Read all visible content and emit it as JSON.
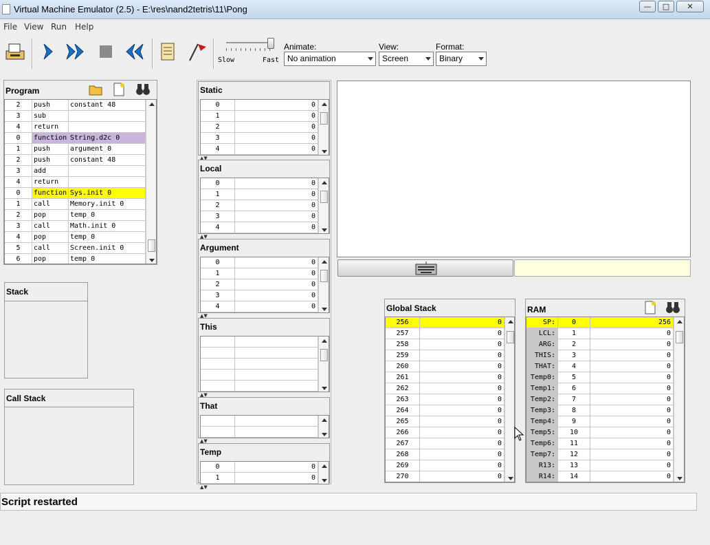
{
  "window": {
    "title": "Virtual Machine Emulator (2.5) - E:\\res\\nand2tetris\\11\\Pong"
  },
  "menu": [
    "File",
    "View",
    "Run",
    "Help"
  ],
  "toolbar": {
    "speed_slow": "Slow",
    "speed_fast": "Fast",
    "animate_label": "Animate:",
    "animate_value": "No animation",
    "view_label": "View:",
    "view_value": "Screen",
    "format_label": "Format:",
    "format_value": "Binary"
  },
  "program": {
    "title": "Program",
    "rows": [
      {
        "n": "2",
        "cmd": "push",
        "arg": "constant 48",
        "hl": ""
      },
      {
        "n": "3",
        "cmd": "sub",
        "arg": "",
        "hl": ""
      },
      {
        "n": "4",
        "cmd": "return",
        "arg": "",
        "hl": ""
      },
      {
        "n": "0",
        "cmd": "function",
        "arg": "String.d2c 0",
        "hl": "purple"
      },
      {
        "n": "1",
        "cmd": "push",
        "arg": "argument 0",
        "hl": ""
      },
      {
        "n": "2",
        "cmd": "push",
        "arg": "constant 48",
        "hl": ""
      },
      {
        "n": "3",
        "cmd": "add",
        "arg": "",
        "hl": ""
      },
      {
        "n": "4",
        "cmd": "return",
        "arg": "",
        "hl": ""
      },
      {
        "n": "0",
        "cmd": "function",
        "arg": "Sys.init 0",
        "hl": "yellow"
      },
      {
        "n": "1",
        "cmd": "call",
        "arg": "Memory.init 0",
        "hl": ""
      },
      {
        "n": "2",
        "cmd": "pop",
        "arg": "temp 0",
        "hl": ""
      },
      {
        "n": "3",
        "cmd": "call",
        "arg": "Math.init 0",
        "hl": ""
      },
      {
        "n": "4",
        "cmd": "pop",
        "arg": "temp 0",
        "hl": ""
      },
      {
        "n": "5",
        "cmd": "call",
        "arg": "Screen.init 0",
        "hl": ""
      },
      {
        "n": "6",
        "cmd": "pop",
        "arg": "temp 0",
        "hl": ""
      }
    ]
  },
  "stack": {
    "title": "Stack"
  },
  "call_stack": {
    "title": "Call Stack"
  },
  "segments": {
    "static": {
      "title": "Static",
      "rows": [
        [
          "0",
          "0"
        ],
        [
          "1",
          "0"
        ],
        [
          "2",
          "0"
        ],
        [
          "3",
          "0"
        ],
        [
          "4",
          "0"
        ]
      ]
    },
    "local": {
      "title": "Local",
      "rows": [
        [
          "0",
          "0"
        ],
        [
          "1",
          "0"
        ],
        [
          "2",
          "0"
        ],
        [
          "3",
          "0"
        ],
        [
          "4",
          "0"
        ]
      ]
    },
    "argument": {
      "title": "Argument",
      "rows": [
        [
          "0",
          "0"
        ],
        [
          "1",
          "0"
        ],
        [
          "2",
          "0"
        ],
        [
          "3",
          "0"
        ],
        [
          "4",
          "0"
        ]
      ]
    },
    "this": {
      "title": "This",
      "rows": [
        [
          "",
          ""
        ],
        [
          "",
          ""
        ],
        [
          "",
          ""
        ],
        [
          "",
          ""
        ],
        [
          "",
          ""
        ]
      ]
    },
    "that": {
      "title": "That",
      "rows": [
        [
          "",
          ""
        ],
        [
          "",
          ""
        ]
      ]
    },
    "temp": {
      "title": "Temp",
      "rows": [
        [
          "0",
          "0"
        ],
        [
          "1",
          "0"
        ]
      ]
    }
  },
  "global_stack": {
    "title": "Global Stack",
    "rows": [
      [
        "256",
        "0"
      ],
      [
        "257",
        "0"
      ],
      [
        "258",
        "0"
      ],
      [
        "259",
        "0"
      ],
      [
        "260",
        "0"
      ],
      [
        "261",
        "0"
      ],
      [
        "262",
        "0"
      ],
      [
        "263",
        "0"
      ],
      [
        "264",
        "0"
      ],
      [
        "265",
        "0"
      ],
      [
        "266",
        "0"
      ],
      [
        "267",
        "0"
      ],
      [
        "268",
        "0"
      ],
      [
        "269",
        "0"
      ],
      [
        "270",
        "0"
      ]
    ]
  },
  "ram": {
    "title": "RAM",
    "rows": [
      [
        "SP:",
        "0",
        "256"
      ],
      [
        "LCL:",
        "1",
        "0"
      ],
      [
        "ARG:",
        "2",
        "0"
      ],
      [
        "THIS:",
        "3",
        "0"
      ],
      [
        "THAT:",
        "4",
        "0"
      ],
      [
        "Temp0:",
        "5",
        "0"
      ],
      [
        "Temp1:",
        "6",
        "0"
      ],
      [
        "Temp2:",
        "7",
        "0"
      ],
      [
        "Temp3:",
        "8",
        "0"
      ],
      [
        "Temp4:",
        "9",
        "0"
      ],
      [
        "Temp5:",
        "10",
        "0"
      ],
      [
        "Temp6:",
        "11",
        "0"
      ],
      [
        "Temp7:",
        "12",
        "0"
      ],
      [
        "R13:",
        "13",
        "0"
      ],
      [
        "R14:",
        "14",
        "0"
      ]
    ]
  },
  "status": {
    "message": "Script restarted"
  },
  "colors": {
    "highlight_yellow": "#ffff00",
    "highlight_purple": "#c8b4dc",
    "screen_bg": "#ffffff",
    "keyboard_bg": "#ffffe0"
  }
}
